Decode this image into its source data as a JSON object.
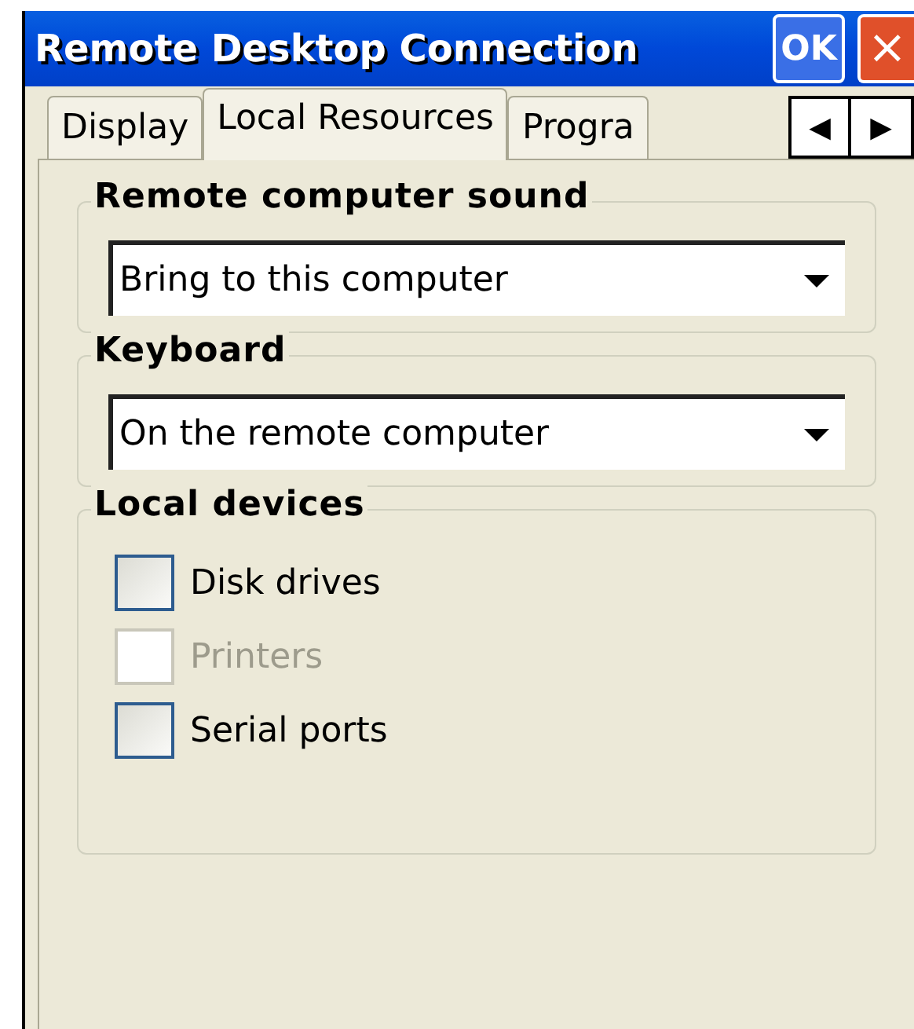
{
  "window": {
    "title": "Remote Desktop Connection",
    "ok_button": "OK",
    "close_button": "×"
  },
  "tabs": [
    {
      "label": "Display",
      "selected": false
    },
    {
      "label": "Local Resources",
      "selected": true
    },
    {
      "label": "Progra",
      "selected": false
    }
  ],
  "tab_scroll": {
    "left": "◀",
    "right": "▶"
  },
  "groups": [
    {
      "kind": "dropdown",
      "title": "Remote computer sound",
      "value": "Bring to this computer"
    },
    {
      "kind": "dropdown",
      "title": "Keyboard",
      "value": "On the remote computer"
    },
    {
      "kind": "checkboxes",
      "title": "Local devices",
      "items": [
        {
          "label": "Disk drives",
          "checked": false,
          "disabled": false
        },
        {
          "label": "Printers",
          "checked": false,
          "disabled": true
        },
        {
          "label": "Serial ports",
          "checked": false,
          "disabled": false
        }
      ]
    }
  ]
}
